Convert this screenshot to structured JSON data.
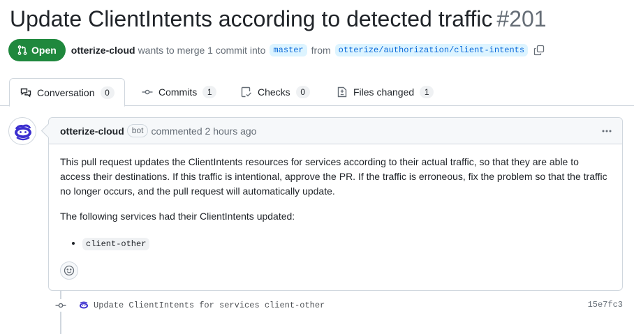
{
  "pr": {
    "title": "Update ClientIntents according to detected traffic",
    "number": "#201",
    "state": "Open",
    "author": "otterize-cloud",
    "merge_text": "wants to merge 1 commit into",
    "base_branch": "master",
    "from_text": "from",
    "head_branch": "otterize/authorization/client-intents"
  },
  "tabs": [
    {
      "label": "Conversation",
      "count": "0",
      "icon": "comment-discussion-icon"
    },
    {
      "label": "Commits",
      "count": "1",
      "icon": "git-commit-icon"
    },
    {
      "label": "Checks",
      "count": "0",
      "icon": "checklist-icon"
    },
    {
      "label": "Files changed",
      "count": "1",
      "icon": "file-diff-icon"
    }
  ],
  "comment": {
    "author": "otterize-cloud",
    "badge": "bot",
    "action": "commented",
    "time": "2 hours ago",
    "body_p1": "This pull request updates the ClientIntents resources for services according to their actual traffic, so that they are able to access their destinations. If this traffic is intentional, approve the PR. If the traffic is erroneous, fix the problem so that the traffic no longer occurs, and the pull request will automatically update.",
    "body_p2": "The following services had their ClientIntents updated:",
    "services": [
      "client-other"
    ]
  },
  "commit": {
    "message": "Update ClientIntents for services client-other",
    "sha": "15e7fc3"
  },
  "colors": {
    "open_green": "#1f883d",
    "branch_bg": "#ddf4ff",
    "link_blue": "#0969da",
    "border": "#d0d7de",
    "otter_purple": "#3b2ecf"
  }
}
